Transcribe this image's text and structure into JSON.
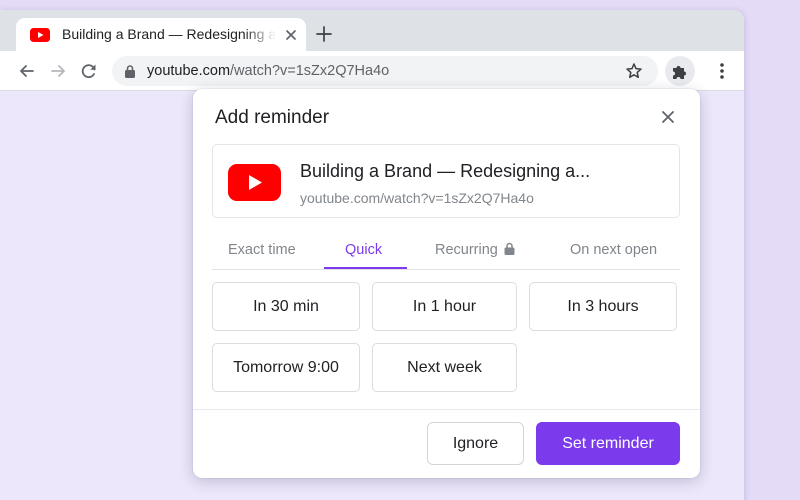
{
  "colors": {
    "accent": "#7c3aed",
    "youtube_red": "#ff0000",
    "background": "#e4dcf7"
  },
  "browser": {
    "tab": {
      "title": "Building a Brand — Redesigning a Hotel",
      "favicon": "youtube-icon"
    },
    "omnibox": {
      "host": "youtube.com",
      "path": "/watch?v=1sZx2Q7Ha4o"
    }
  },
  "popup": {
    "title": "Add reminder",
    "video": {
      "title": "Building a Brand — Redesigning a...",
      "url": "youtube.com/watch?v=1sZx2Q7Ha4o"
    },
    "tabs": [
      {
        "label": "Exact time",
        "active": false
      },
      {
        "label": "Quick",
        "active": true
      },
      {
        "label": "Recurring",
        "active": false,
        "locked": true
      },
      {
        "label": "On next open",
        "active": false
      }
    ],
    "quick_options": [
      "In 30 min",
      "In 1 hour",
      "In 3 hours",
      "Tomorrow 9:00",
      "Next week"
    ],
    "buttons": {
      "ignore": "Ignore",
      "set": "Set reminder"
    }
  }
}
